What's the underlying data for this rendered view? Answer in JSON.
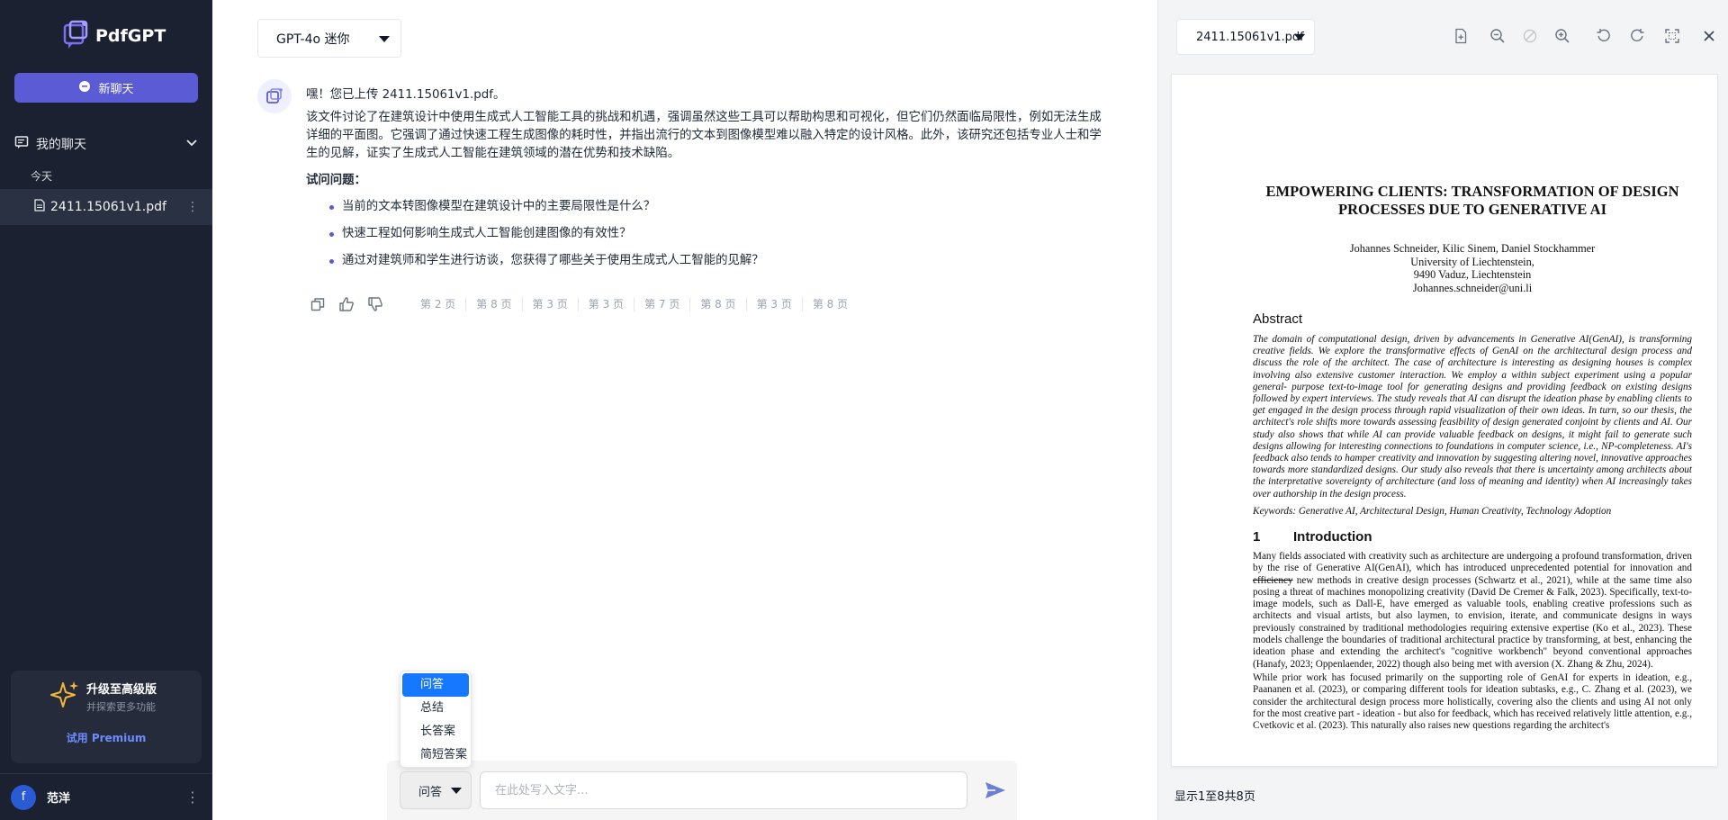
{
  "app": {
    "name": "PdfGPT",
    "new_chat_label": "新聊天",
    "my_chats_label": "我的聊天",
    "today_label": "今天",
    "chat_item_name": "2411.15061v1.pdf",
    "upgrade_title": "升级至高级版",
    "upgrade_subtitle": "并探索更多功能",
    "upgrade_cta": "试用 Premium",
    "user_initial": "f",
    "user_name": "范洋"
  },
  "main": {
    "model_label": "GPT-4o 迷你",
    "greeting": "嘿！您已上传 2411.15061v1.pdf。",
    "summary": "该文件讨论了在建筑设计中使用生成式人工智能工具的挑战和机遇，强调虽然这些工具可以帮助构思和可视化，但它们仍然面临局限性，例如无法生成详细的平面图。它强调了通过快速工程生成图像的耗时性，并指出流行的文本到图像模型难以融入特定的设计风格。此外，该研究还包括专业人士和学生的见解，证实了生成式人工智能在建筑领域的潜在优势和技术缺陷。",
    "questions_title": "试问问题：",
    "questions": [
      "当前的文本转图像模型在建筑设计中的主要局限性是什么？",
      "快速工程如何影响生成式人工智能创建图像的有效性？",
      "通过对建筑师和学生进行访谈，您获得了哪些关于使用生成式人工智能的见解？"
    ],
    "page_refs": [
      "第 2 页",
      "第 8 页",
      "第 3 页",
      "第 3 页",
      "第 7 页",
      "第 8 页",
      "第 3 页",
      "第 8 页"
    ],
    "mode_options": [
      "问答",
      "总结",
      "长答案",
      "简短答案"
    ],
    "mode_selected": "问答",
    "input_placeholder": "在此处写入文字..."
  },
  "pdf": {
    "file_name": "2411.15061v1.pdf",
    "title": "EMPOWERING CLIENTS: TRANSFORMATION OF DESIGN PROCESSES DUE TO GENERATIVE AI",
    "authors": "Johannes Schneider, Kilic Sinem, Daniel Stockhammer",
    "affiliation": "University of Liechtenstein,",
    "address": "9490 Vaduz, Liechtenstein",
    "email": "Johannes.schneider@uni.li",
    "abstract_heading": "Abstract",
    "abstract": "The domain of computational design, driven by advancements in Generative AI(GenAI), is transforming creative fields. We explore the transformative effects of GenAI on the architectural design process and discuss the role of the architect. The case of architecture is interesting as designing houses is complex involving also extensive customer interaction. We employ a within subject experiment using a popular general- purpose text-to-image tool for generating designs and providing feedback on existing designs followed by expert interviews. The study reveals that AI can disrupt the ideation phase by enabling clients to get engaged in the design process through rapid visualization of their own ideas. In turn, so our thesis, the architect's role shifts more towards assessing feasibility of design generated conjoint by clients and AI. Our study also shows that while AI can provide valuable feedback on designs, it might fail to generate such designs allowing for interesting connections to foundations in computer science, i.e., NP-completeness. AI's feedback also tends to hamper creativity and innovation by suggesting altering novel, innovative approaches towards more standardized designs. Our study also reveals that there is uncertainty among architects about the interpretative sovereignty of architecture (and loss of meaning and identity) when AI increasingly takes over authorship in the design process.",
    "keywords": "Keywords: Generative AI, Architectural Design, Human Creativity, Technology Adoption",
    "section_num": "1",
    "section_title": "Introduction",
    "body_p1_a": "Many fields associated with creativity such as architecture are undergoing a profound transformation, driven by the rise of Generative AI(GenAI), which has introduced unprecedented potential for innovation and ",
    "body_p1_strike": "efficiency",
    "body_p1_b": " new methods in creative design processes (Schwartz et al., 2021), while at the same time also posing a threat of machines monopolizing creativity (David De Cremer & Falk, 2023). Specifically, text-to-image models, such as Dall-E, have emerged as valuable tools, enabling creative professions such as architects and visual artists, but also laymen, to envision, iterate, and communicate designs in ways previously constrained by traditional methodologies requiring extensive expertise (Ko et al., 2023). These models challenge the boundaries of traditional architectural practice by transforming, at best, enhancing the ideation phase and extending the architect's \"cognitive workbench\" beyond conventional approaches (Hanafy, 2023; Oppenlaender, 2022) though also being met with aversion (X. Zhang & Zhu, 2024).",
    "body_p2": "While prior work has focused primarily on the supporting role of GenAI for experts in ideation, e.g., Paananen et al. (2023), or comparing different tools for ideation subtasks, e.g., C. Zhang et al. (2023), we consider the architectural design process more holistically, covering also the clients and using AI not only for the most creative part - ideation - but also for feedback, which has received relatively little attention, e.g., Cvetkovic et al. (2023). This naturally also raises new questions regarding the architect's",
    "page_count": "显示1至8共8页"
  }
}
